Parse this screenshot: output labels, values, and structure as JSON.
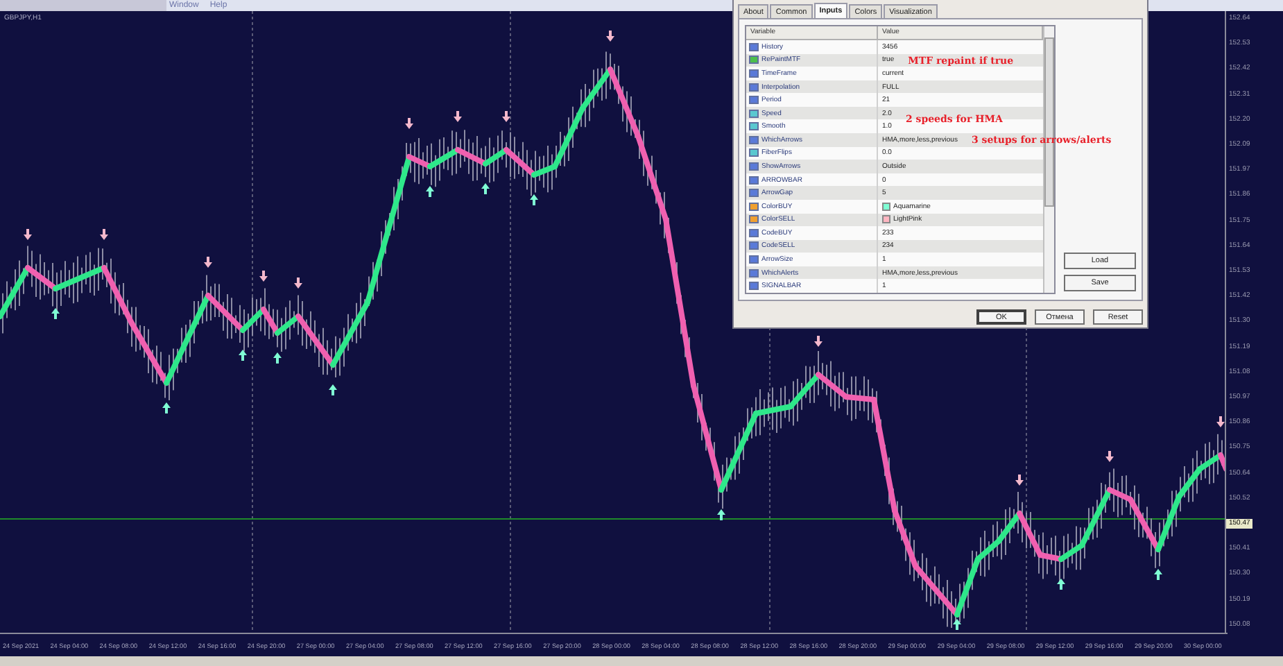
{
  "menu": [
    "Window",
    "Help"
  ],
  "chart_label": "GBPJPY,H1",
  "price_axis": [
    {
      "label": "152.64",
      "kind": "tick"
    },
    {
      "label": "152.53",
      "kind": "tick"
    },
    {
      "label": "152.42",
      "kind": "tick"
    },
    {
      "label": "152.31",
      "kind": "tick"
    },
    {
      "label": "152.20",
      "kind": "tick"
    },
    {
      "label": "152.09",
      "kind": "tick"
    },
    {
      "label": "151.97",
      "kind": "tick"
    },
    {
      "label": "151.86",
      "kind": "tick"
    },
    {
      "label": "151.75",
      "kind": "tick"
    },
    {
      "label": "151.64",
      "kind": "tick"
    },
    {
      "label": "151.53",
      "kind": "tick"
    },
    {
      "label": "151.42",
      "kind": "tick"
    },
    {
      "label": "151.30",
      "kind": "tick"
    },
    {
      "label": "151.19",
      "kind": "tick"
    },
    {
      "label": "151.08",
      "kind": "tick"
    },
    {
      "label": "150.97",
      "kind": "tick"
    },
    {
      "label": "150.86",
      "kind": "tick"
    },
    {
      "label": "150.75",
      "kind": "tick"
    },
    {
      "label": "150.64",
      "kind": "tick"
    },
    {
      "label": "150.52",
      "kind": "tick"
    },
    {
      "label": "150.47",
      "kind": "current"
    },
    {
      "label": "150.41",
      "kind": "tick"
    },
    {
      "label": "150.30",
      "kind": "tick"
    },
    {
      "label": "150.19",
      "kind": "tick"
    },
    {
      "label": "150.08",
      "kind": "tick"
    }
  ],
  "time_axis": [
    "24 Sep 2021",
    "24 Sep 04:00",
    "24 Sep 08:00",
    "24 Sep 12:00",
    "24 Sep 16:00",
    "24 Sep 20:00",
    "27 Sep 00:00",
    "27 Sep 04:00",
    "27 Sep 08:00",
    "27 Sep 12:00",
    "27 Sep 16:00",
    "27 Sep 20:00",
    "28 Sep 00:00",
    "28 Sep 04:00",
    "28 Sep 08:00",
    "28 Sep 12:00",
    "28 Sep 16:00",
    "28 Sep 20:00",
    "29 Sep 00:00",
    "29 Sep 04:00",
    "29 Sep 08:00",
    "29 Sep 12:00",
    "29 Sep 16:00",
    "29 Sep 20:00",
    "30 Sep 00:00"
  ],
  "dialog": {
    "tabs": [
      {
        "label": "About",
        "selected": false
      },
      {
        "label": "Common",
        "selected": false
      },
      {
        "label": "Inputs",
        "selected": true
      },
      {
        "label": "Colors",
        "selected": false
      },
      {
        "label": "Visualization",
        "selected": false
      }
    ],
    "columns": [
      "Variable",
      "Value"
    ],
    "rows": [
      {
        "kind": "int",
        "variable": "History",
        "value": "3456",
        "note": ""
      },
      {
        "kind": "bool",
        "variable": "RePaintMTF",
        "value": "true",
        "note": "MTF repaint if true"
      },
      {
        "kind": "int",
        "variable": "TimeFrame",
        "value": "current"
      },
      {
        "kind": "int",
        "variable": "Interpolation",
        "value": "FULL"
      },
      {
        "kind": "int",
        "variable": "Period",
        "value": "21"
      },
      {
        "kind": "double",
        "variable": "Speed",
        "value": "2.0",
        "note": "2 speeds for HMA"
      },
      {
        "kind": "double",
        "variable": "Smooth",
        "value": "1.0"
      },
      {
        "kind": "int",
        "variable": "WhichArrows",
        "value": "HMA,more,less,previous",
        "note": "3 setups for arrows/alerts"
      },
      {
        "kind": "double",
        "variable": "FiberFlips",
        "value": "0.0"
      },
      {
        "kind": "int",
        "variable": "ShowArrows",
        "value": "Outside"
      },
      {
        "kind": "int",
        "variable": "ARROWBAR",
        "value": "0"
      },
      {
        "kind": "int",
        "variable": "ArrowGap",
        "value": "5"
      },
      {
        "kind": "color",
        "variable": "ColorBUY",
        "value": "Aquamarine",
        "color": "#7fffd4"
      },
      {
        "kind": "color",
        "variable": "ColorSELL",
        "value": "LightPink",
        "color": "#ffb6c1"
      },
      {
        "kind": "int",
        "variable": "CodeBUY",
        "value": "233"
      },
      {
        "kind": "int",
        "variable": "CodeSELL",
        "value": "234"
      },
      {
        "kind": "int",
        "variable": "ArrowSize",
        "value": "1"
      },
      {
        "kind": "int",
        "variable": "WhichAlerts",
        "value": "HMA,more,less,previous"
      },
      {
        "kind": "int",
        "variable": "SIGNALBAR",
        "value": "1"
      }
    ],
    "side_buttons": [
      "Load",
      "Save"
    ],
    "buttons": [
      "OK",
      "Отмена",
      "Reset"
    ]
  }
}
